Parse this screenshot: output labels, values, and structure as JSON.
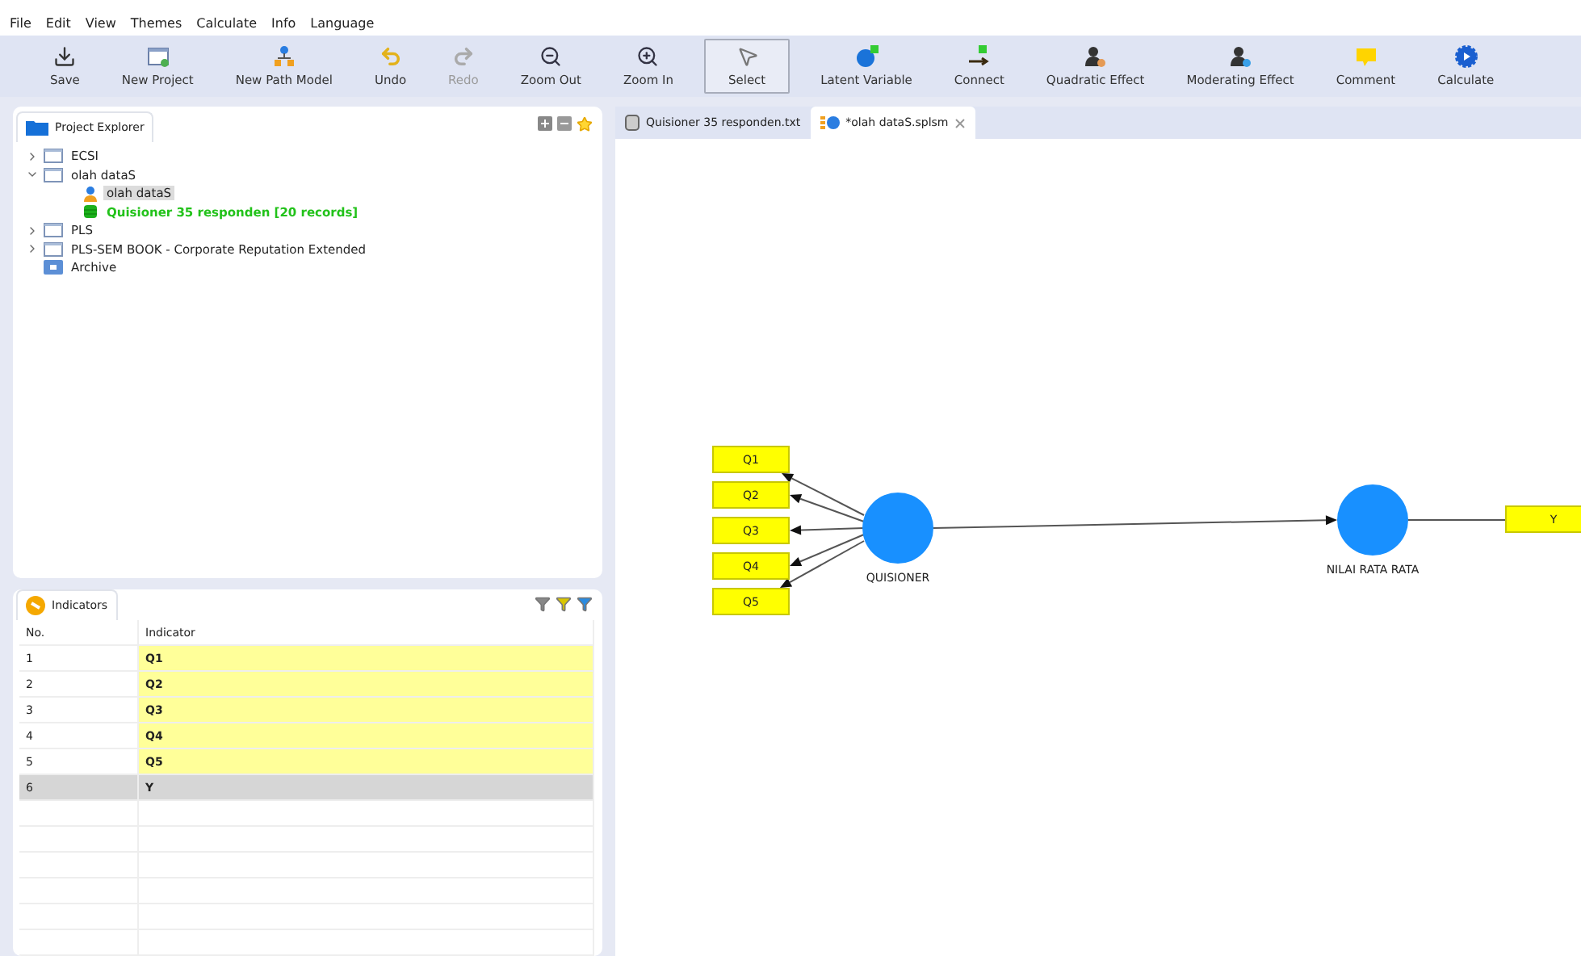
{
  "menu": [
    "File",
    "Edit",
    "View",
    "Themes",
    "Calculate",
    "Info",
    "Language"
  ],
  "toolbar": [
    {
      "kind": "save",
      "label": "Save",
      "disabled": false,
      "selected": false
    },
    {
      "kind": "new-project",
      "label": "New Project",
      "disabled": false,
      "selected": false
    },
    {
      "kind": "new-model",
      "label": "New Path Model",
      "disabled": false,
      "selected": false
    },
    {
      "kind": "undo",
      "label": "Undo",
      "disabled": false,
      "selected": false
    },
    {
      "kind": "redo",
      "label": "Redo",
      "disabled": true,
      "selected": false
    },
    {
      "kind": "zoom-out",
      "label": "Zoom Out",
      "disabled": false,
      "selected": false
    },
    {
      "kind": "zoom-in",
      "label": "Zoom In",
      "disabled": false,
      "selected": false
    },
    {
      "kind": "select",
      "label": "Select",
      "disabled": false,
      "selected": true
    },
    {
      "kind": "latent",
      "label": "Latent Variable",
      "disabled": false,
      "selected": false
    },
    {
      "kind": "connect",
      "label": "Connect",
      "disabled": false,
      "selected": false
    },
    {
      "kind": "quadratic",
      "label": "Quadratic Effect",
      "disabled": false,
      "selected": false
    },
    {
      "kind": "moderating",
      "label": "Moderating Effect",
      "disabled": false,
      "selected": false
    },
    {
      "kind": "comment",
      "label": "Comment",
      "disabled": false,
      "selected": false
    },
    {
      "kind": "calculate",
      "label": "Calculate",
      "disabled": false,
      "selected": false
    }
  ],
  "explorer": {
    "title": "Project Explorer",
    "items": [
      {
        "kind": "project",
        "label": "ECSI",
        "expanded": false,
        "selected": false
      },
      {
        "kind": "project",
        "label": "olah dataS",
        "expanded": true,
        "selected": false,
        "children": [
          {
            "kind": "model",
            "label": "olah dataS",
            "selected": true
          },
          {
            "kind": "data",
            "label": "Quisioner 35 responden [20 records]",
            "selected": false
          }
        ]
      },
      {
        "kind": "project",
        "label": "PLS",
        "expanded": false,
        "selected": false
      },
      {
        "kind": "project",
        "label": "PLS-SEM BOOK - Corporate Reputation Extended",
        "expanded": false,
        "selected": false
      },
      {
        "kind": "archive",
        "label": "Archive",
        "selected": false
      }
    ]
  },
  "indicators": {
    "title": "Indicators",
    "columns": [
      "No.",
      "Indicator"
    ],
    "rows": [
      {
        "no": "1",
        "name": "Q1",
        "selected": false
      },
      {
        "no": "2",
        "name": "Q2",
        "selected": false
      },
      {
        "no": "3",
        "name": "Q3",
        "selected": false
      },
      {
        "no": "4",
        "name": "Q4",
        "selected": false
      },
      {
        "no": "5",
        "name": "Q5",
        "selected": false
      },
      {
        "no": "6",
        "name": "Y",
        "selected": true
      }
    ]
  },
  "editor_tabs": [
    {
      "kind": "data",
      "label": "Quisioner 35 responden.txt",
      "selected": false
    },
    {
      "kind": "model",
      "label": "*olah dataS.splsm",
      "selected": true
    }
  ],
  "diagram": {
    "constructs": [
      {
        "name": "QUISIONER",
        "indicators": [
          "Q1",
          "Q2",
          "Q3",
          "Q4",
          "Q5"
        ]
      },
      {
        "name": "NILAI RATA RATA",
        "indicators": [
          "Y"
        ]
      }
    ]
  }
}
